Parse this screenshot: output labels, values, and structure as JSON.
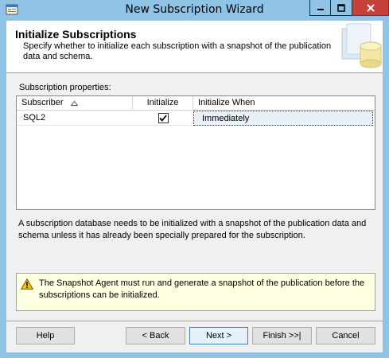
{
  "window": {
    "title": "New Subscription Wizard",
    "app_icon": "wizard-app-icon",
    "controls": {
      "minimize_icon": "minimize-icon",
      "maximize_icon": "maximize-icon",
      "close_icon": "close-icon"
    }
  },
  "header": {
    "title": "Initialize Subscriptions",
    "description": "Specify whether to initialize each subscription with a snapshot of the publication data and schema.",
    "graphic": "database-cylinder-graphic"
  },
  "grid": {
    "label": "Subscription properties:",
    "columns": [
      "Subscriber",
      "Initialize",
      "Initialize When"
    ],
    "sort_icon": "sort-ascending-icon",
    "rows": [
      {
        "subscriber": "SQL2",
        "initialize": true,
        "initialize_when": "Immediately"
      }
    ]
  },
  "info_text": "A subscription database needs to be initialized with a snapshot of the publication data and schema unless it has already been specially prepared for the subscription.",
  "warning": {
    "icon": "warning-icon",
    "text": "The Snapshot Agent must run and generate a snapshot of the publication before the subscriptions can be initialized."
  },
  "buttons": {
    "help": "Help",
    "back": "< Back",
    "next": "Next >",
    "finish": "Finish >>|",
    "cancel": "Cancel"
  },
  "colors": {
    "frame": "#8fc4e6",
    "close_button": "#c7413b",
    "warning_bg": "#ffffe1",
    "selected_cell": "#e8f0f8"
  }
}
